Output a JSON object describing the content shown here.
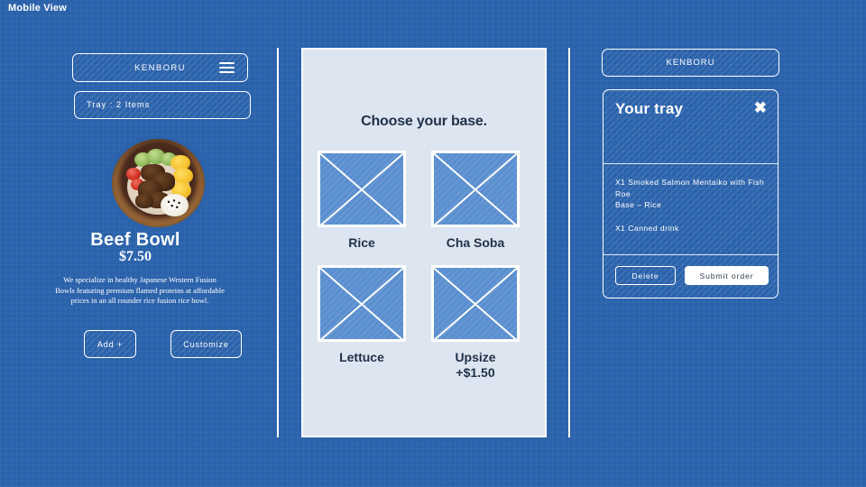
{
  "page": {
    "title": "Mobile View",
    "background_color": "#2a62ab",
    "panel_color": "#dde5f0",
    "accent_text_color": "#1f3148",
    "placeholder_color": "#5b8fd0"
  },
  "mobile": {
    "brand": "KENBORU",
    "menu_icon": "hamburger-icon",
    "tray_summary": "Tray : 2 Items",
    "product": {
      "image_alt": "beef-bowl-photo",
      "name": "Beef Bowl",
      "price": "$7.50",
      "description": "We specialize in healthy Japanese Western Fusion Bowls featuring premium flamed proteins at affordable prices in an all rounder rice fusion rice bowl."
    },
    "actions": {
      "add": "Add +",
      "customize": "Customize"
    }
  },
  "base_panel": {
    "heading": "Choose your base.",
    "options": [
      {
        "label": "Rice",
        "sublabel": "",
        "image": "placeholder-image"
      },
      {
        "label": "Cha Soba",
        "sublabel": "",
        "image": "placeholder-image"
      },
      {
        "label": "Lettuce",
        "sublabel": "",
        "image": "placeholder-image"
      },
      {
        "label": "Upsize",
        "sublabel": "+$1.50",
        "image": "placeholder-image"
      }
    ]
  },
  "tray": {
    "brand": "KENBORU",
    "title": "Your tray",
    "close_icon": "close-icon",
    "items": [
      "X1 Smoked Salmon Mentaiko with Fish Roe\nBase – Rice",
      "X1 Canned drink"
    ],
    "item_lines": [
      [
        "X1 Smoked Salmon Mentaiko with Fish Roe",
        "Base – Rice"
      ],
      [
        "X1 Canned drink"
      ]
    ],
    "delete_label": "Delete",
    "submit_label": "Submit order"
  }
}
